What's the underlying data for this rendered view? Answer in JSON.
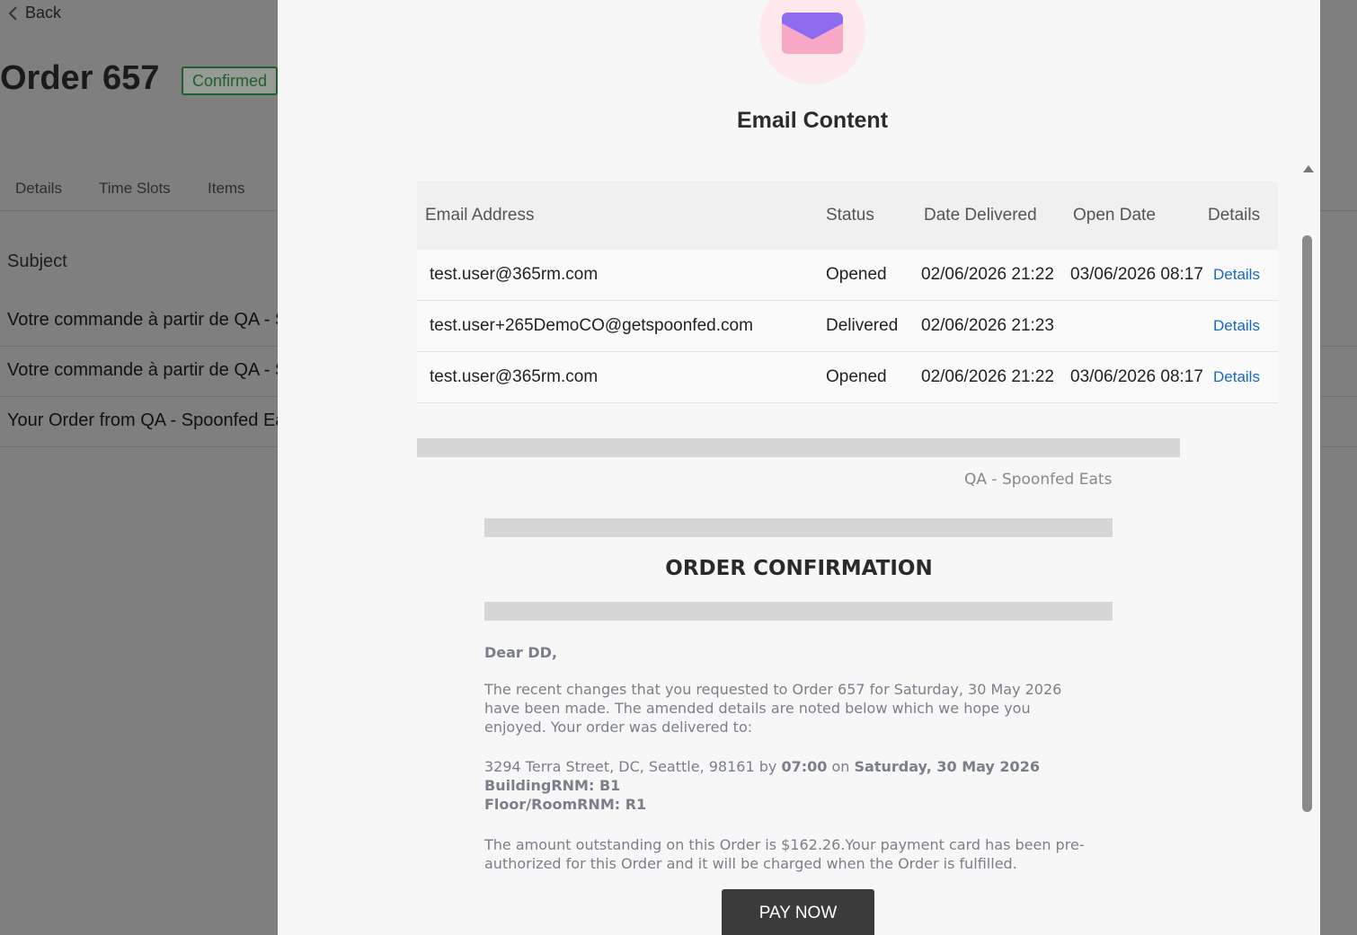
{
  "background": {
    "back_label": "Back",
    "order_title": "Order 657",
    "status_badge": "Confirmed",
    "tabs": [
      "Details",
      "Time Slots",
      "Items"
    ],
    "subject_header": "Subject",
    "rows": [
      "Votre commande à partir de QA - S",
      "Votre commande à partir de QA - S",
      "Your Order from QA - Spoonfed Ea"
    ]
  },
  "modal": {
    "icon": "envelope-icon",
    "title": "Email Content",
    "table": {
      "headers": [
        "Email Address",
        "Status",
        "Date Delivered",
        "Open Date",
        "Details"
      ],
      "rows": [
        {
          "email": "test.user@365rm.com",
          "status": "Opened",
          "delivered": "02/06/2026 21:22",
          "opened": "03/06/2026 08:17",
          "details": "Details"
        },
        {
          "email": "test.user+265DemoCO@getspoonfed.com",
          "status": "Delivered",
          "delivered": "02/06/2026 21:23",
          "opened": "",
          "details": "Details"
        },
        {
          "email": "test.user@365rm.com",
          "status": "Opened",
          "delivered": "02/06/2026 21:22",
          "opened": "03/06/2026 08:17",
          "details": "Details"
        }
      ]
    },
    "email": {
      "brand": "QA - Spoonfed Eats",
      "heading": "ORDER CONFIRMATION",
      "greeting": "Dear DD,",
      "paragraph1": "The recent changes that you requested to Order 657 for Saturday, 30 May 2026 have been made. The amended details are noted below which we hope you enjoyed. Your order was delivered to:",
      "address": "3294 Terra Street, DC, Seattle, 98161",
      "by_word": "by",
      "time": "07:00",
      "on_word": "on",
      "date": "Saturday, 30 May 2026",
      "building": "BuildingRNM: B1",
      "floor": "Floor/RoomRNM: R1",
      "paragraph2": "The amount outstanding on this Order is $162.26.Your payment card has been pre-authorized for this Order and it will be charged when the Order is fulfilled.",
      "pay_button": "PAY NOW"
    }
  },
  "colors": {
    "accent_link": "#1769c9",
    "badge_green": "#1f5f2e",
    "icon_purple": "#8e6cf0",
    "icon_pink": "#f7a9c6"
  }
}
